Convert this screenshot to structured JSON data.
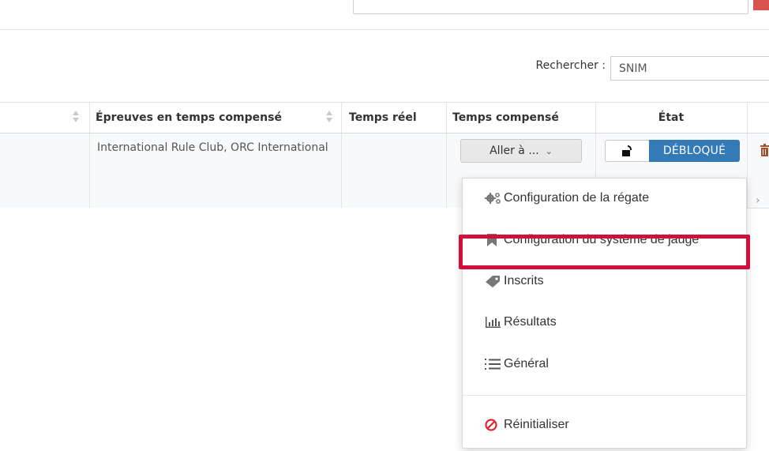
{
  "search": {
    "label": "Rechercher :",
    "value": "SNIM"
  },
  "table": {
    "columns": [
      {
        "label": "Épreuves en temps compensé",
        "sortable": true
      },
      {
        "label": "Temps réel",
        "sortable": false
      },
      {
        "label": "Temps compensé",
        "sortable": false
      },
      {
        "label": "État",
        "sortable": false
      }
    ],
    "rows": [
      {
        "epreuves": "International Rule Club, ORC International",
        "action_button": "Aller à ...",
        "state": "DÉBLOQUÉ"
      }
    ]
  },
  "dropdown": {
    "items": [
      {
        "label": "Configuration de la régate",
        "icon": "cogs-icon"
      },
      {
        "label": "Configuration du système de jauge",
        "icon": "bookmark-icon",
        "highlighted": true
      },
      {
        "label": "Inscrits",
        "icon": "tag-icon"
      },
      {
        "label": "Résultats",
        "icon": "bar-chart-icon"
      },
      {
        "label": "Général",
        "icon": "numbered-list-icon"
      },
      {
        "label": "Réinitialiser",
        "icon": "ban-icon"
      }
    ]
  },
  "colors": {
    "state_badge": "#337ab7",
    "highlight": "#d10f3c",
    "reset_icon": "#e0262e",
    "trash_icon": "#a0522d"
  }
}
